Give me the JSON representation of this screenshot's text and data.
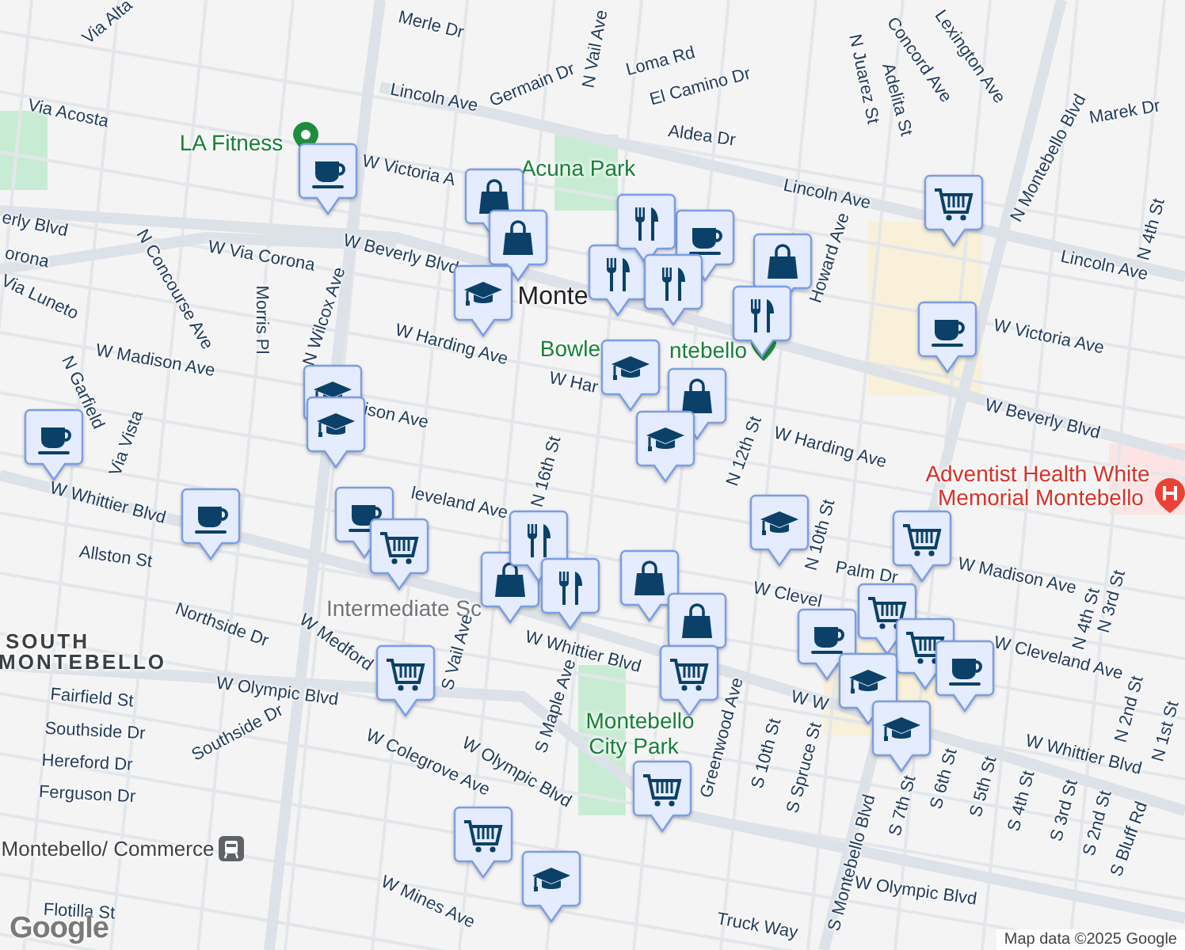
{
  "map": {
    "labels": [
      {
        "text": "Via Alta",
        "kind": "street"
      },
      {
        "text": "Merle Dr",
        "kind": "street"
      },
      {
        "text": "N Vail Ave",
        "kind": "street"
      },
      {
        "text": "Germain Dr",
        "kind": "street"
      },
      {
        "text": "Loma Rd",
        "kind": "street"
      },
      {
        "text": "El Camino Dr",
        "kind": "street"
      },
      {
        "text": "Lincoln Ave",
        "kind": "street"
      },
      {
        "text": "Aldea Dr",
        "kind": "street"
      },
      {
        "text": "N Juarez St",
        "kind": "street"
      },
      {
        "text": "Adelita St",
        "kind": "street"
      },
      {
        "text": "Concord Ave",
        "kind": "street"
      },
      {
        "text": "Lexington Ave",
        "kind": "street"
      },
      {
        "text": "Lincoln Ave",
        "kind": "street"
      },
      {
        "text": "N Montebello Blvd",
        "kind": "street"
      },
      {
        "text": "Marek Dr",
        "kind": "street"
      },
      {
        "text": "Lincoln Ave",
        "kind": "street"
      },
      {
        "text": "N 4th St",
        "kind": "street"
      },
      {
        "text": "Via Acosta",
        "kind": "street"
      },
      {
        "text": "LA Fitness",
        "kind": "park"
      },
      {
        "text": "W Victoria A",
        "kind": "street"
      },
      {
        "text": "Acuna Park",
        "kind": "park"
      },
      {
        "text": "erly Blvd",
        "kind": "street"
      },
      {
        "text": "W Beverly Blvd",
        "kind": "street"
      },
      {
        "text": "W Via Corona",
        "kind": "street"
      },
      {
        "text": "orona",
        "kind": "street"
      },
      {
        "text": "N Concourse Ave",
        "kind": "street"
      },
      {
        "text": "Morris Pl",
        "kind": "street"
      },
      {
        "text": "N Wilcox Ave",
        "kind": "street"
      },
      {
        "text": "Via Luneto",
        "kind": "street"
      },
      {
        "text": "Monte",
        "kind": "city"
      },
      {
        "text": "Bowle",
        "kind": "park"
      },
      {
        "text": "ntebello",
        "kind": "park"
      },
      {
        "text": "W Harding Ave",
        "kind": "street"
      },
      {
        "text": "W Har",
        "kind": "street"
      },
      {
        "text": "W Madison Ave",
        "kind": "street"
      },
      {
        "text": "ison Ave",
        "kind": "street"
      },
      {
        "text": "Howard Ave",
        "kind": "street"
      },
      {
        "text": "W Victoria Ave",
        "kind": "street"
      },
      {
        "text": "W Beverly Blvd",
        "kind": "street"
      },
      {
        "text": "W Harding Ave",
        "kind": "street"
      },
      {
        "text": "N 12th St",
        "kind": "street"
      },
      {
        "text": "Via Vista",
        "kind": "street"
      },
      {
        "text": "N Garfield",
        "kind": "street"
      },
      {
        "text": "Adventist Health White",
        "kind": "hospital"
      },
      {
        "text": "Memorial Montebello",
        "kind": "hospital"
      },
      {
        "text": "W Whittier Blvd",
        "kind": "street"
      },
      {
        "text": "Allston St",
        "kind": "street"
      },
      {
        "text": "leveland Ave",
        "kind": "street"
      },
      {
        "text": "N 16th St",
        "kind": "street"
      },
      {
        "text": "Intermediate Sc",
        "kind": "school"
      },
      {
        "text": "W Whittier Blvd",
        "kind": "street"
      },
      {
        "text": "Northside Dr",
        "kind": "street"
      },
      {
        "text": "SOUTH",
        "kind": "area"
      },
      {
        "text": "MONTEBELLO",
        "kind": "area"
      },
      {
        "text": "W Medford",
        "kind": "street"
      },
      {
        "text": "S Vail Ave",
        "kind": "street"
      },
      {
        "text": "W Olympic Blvd",
        "kind": "street"
      },
      {
        "text": "Fairfield St",
        "kind": "street"
      },
      {
        "text": "Southside Dr",
        "kind": "street"
      },
      {
        "text": "Southside Dr",
        "kind": "street"
      },
      {
        "text": "Hereford Dr",
        "kind": "street"
      },
      {
        "text": "Ferguson Dr",
        "kind": "street"
      },
      {
        "text": "W Colegrove Ave",
        "kind": "street"
      },
      {
        "text": "W Olympic Blvd",
        "kind": "street"
      },
      {
        "text": "S Maple Ave",
        "kind": "street"
      },
      {
        "text": "Montebello",
        "kind": "park"
      },
      {
        "text": "City Park",
        "kind": "park"
      },
      {
        "text": "Greenwood Ave",
        "kind": "street"
      },
      {
        "text": "S 10th St",
        "kind": "street"
      },
      {
        "text": "S Spruce St",
        "kind": "street"
      },
      {
        "text": "S Montebello Blvd",
        "kind": "street"
      },
      {
        "text": "S 7th St",
        "kind": "street"
      },
      {
        "text": "S 6th St",
        "kind": "street"
      },
      {
        "text": "S 5th St",
        "kind": "street"
      },
      {
        "text": "S 4th St",
        "kind": "street"
      },
      {
        "text": "S 3rd St",
        "kind": "street"
      },
      {
        "text": "S 2nd St",
        "kind": "street"
      },
      {
        "text": "S Bluff Rd",
        "kind": "street"
      },
      {
        "text": "N 10th St",
        "kind": "street"
      },
      {
        "text": "Palm Dr",
        "kind": "street"
      },
      {
        "text": "W Madison Ave",
        "kind": "street"
      },
      {
        "text": "W Clevel",
        "kind": "street"
      },
      {
        "text": "W Cleveland Ave",
        "kind": "street"
      },
      {
        "text": "N 4th St",
        "kind": "street"
      },
      {
        "text": "N 3rd St",
        "kind": "street"
      },
      {
        "text": "W Whittier Blvd",
        "kind": "street"
      },
      {
        "text": "N 2nd St",
        "kind": "street"
      },
      {
        "text": "N 1st St",
        "kind": "street"
      },
      {
        "text": "W Olympic Blvd",
        "kind": "street"
      },
      {
        "text": "Truck Way",
        "kind": "street"
      },
      {
        "text": "Montebello/ Commerce",
        "kind": "transit"
      },
      {
        "text": "W Mines Ave",
        "kind": "street"
      },
      {
        "text": "Flotilla St",
        "kind": "street"
      },
      {
        "text": "W W",
        "kind": "street"
      }
    ],
    "pins": [
      {
        "kind": "school"
      },
      {
        "kind": "school"
      },
      {
        "kind": "coffee"
      },
      {
        "kind": "shopping"
      },
      {
        "kind": "shopping"
      },
      {
        "kind": "school"
      },
      {
        "kind": "restaurant"
      },
      {
        "kind": "coffee"
      },
      {
        "kind": "restaurant"
      },
      {
        "kind": "restaurant"
      },
      {
        "kind": "shopping"
      },
      {
        "kind": "restaurant"
      },
      {
        "kind": "school"
      },
      {
        "kind": "shopping"
      },
      {
        "kind": "school"
      },
      {
        "kind": "grocery"
      },
      {
        "kind": "coffee"
      },
      {
        "kind": "coffee"
      },
      {
        "kind": "coffee"
      },
      {
        "kind": "coffee"
      },
      {
        "kind": "grocery"
      },
      {
        "kind": "shopping"
      },
      {
        "kind": "restaurant"
      },
      {
        "kind": "restaurant"
      },
      {
        "kind": "shopping"
      },
      {
        "kind": "shopping"
      },
      {
        "kind": "grocery"
      },
      {
        "kind": "school"
      },
      {
        "kind": "grocery"
      },
      {
        "kind": "grocery"
      },
      {
        "kind": "grocery"
      },
      {
        "kind": "coffee"
      },
      {
        "kind": "coffee"
      },
      {
        "kind": "school"
      },
      {
        "kind": "school"
      },
      {
        "kind": "grocery"
      },
      {
        "kind": "grocery"
      },
      {
        "kind": "grocery"
      },
      {
        "kind": "school"
      }
    ]
  },
  "logo": "Google",
  "attribution": "Map data ©2025 Google"
}
